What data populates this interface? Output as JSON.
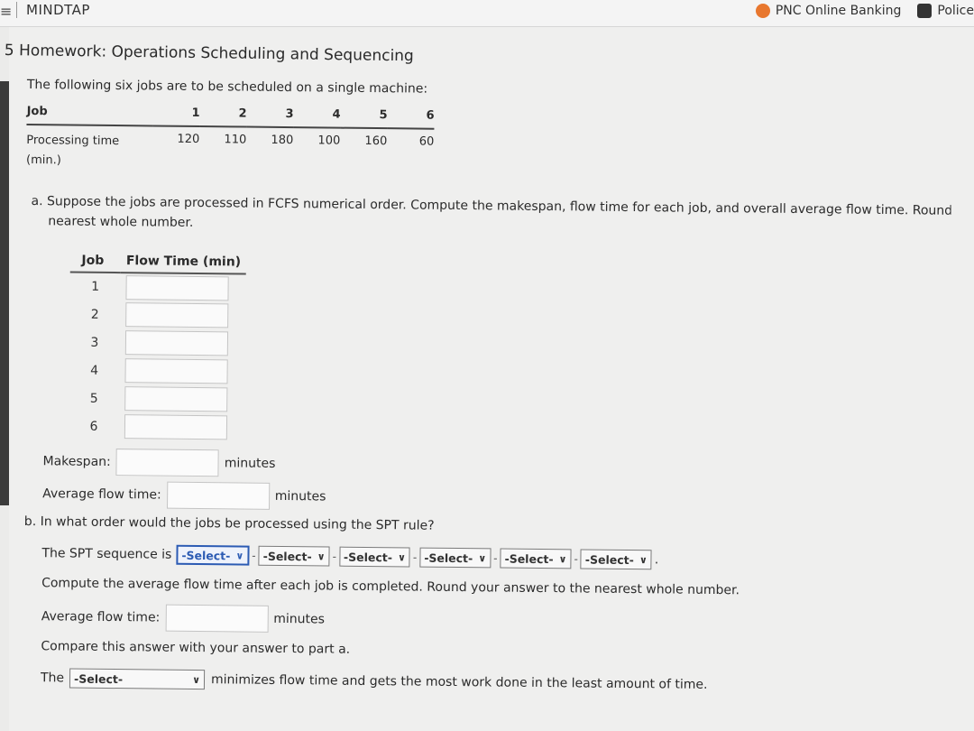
{
  "browser": {
    "brand": "MINDTAP",
    "bookmarks": [
      {
        "label": "PNC Online Banking",
        "icon": "pnc-logo-icon",
        "color": "#e8772e"
      },
      {
        "label": "Police",
        "icon": "police-badge-icon",
        "color": "#333333"
      }
    ]
  },
  "assignment": {
    "title": "5 Homework: Operations Scheduling and Sequencing",
    "intro": "The following six jobs are to be scheduled on a single machine:",
    "jobs_table": {
      "header_label": "Job",
      "jobs": [
        "1",
        "2",
        "3",
        "4",
        "5",
        "6"
      ],
      "row_label_line1": "Processing time",
      "row_label_line2": "(min.)",
      "processing_times": [
        "120",
        "110",
        "180",
        "100",
        "160",
        "60"
      ]
    }
  },
  "part_a": {
    "prompt_line1": "a. Suppose the jobs are processed in FCFS numerical order. Compute the makespan, flow time for each job, and overall average flow time. Round your a",
    "prompt_line2": "nearest whole number.",
    "table_headers": {
      "job": "Job",
      "flow": "Flow Time (min)"
    },
    "rows": [
      {
        "job": "1",
        "value": ""
      },
      {
        "job": "2",
        "value": ""
      },
      {
        "job": "3",
        "value": ""
      },
      {
        "job": "4",
        "value": ""
      },
      {
        "job": "5",
        "value": ""
      },
      {
        "job": "6",
        "value": ""
      }
    ],
    "makespan_label": "Makespan:",
    "makespan_unit": "minutes",
    "avg_label": "Average flow time:",
    "avg_unit": "minutes"
  },
  "part_b": {
    "question": "b. In what order would the jobs be processed using the SPT rule?",
    "sequence_label": "The SPT sequence is",
    "select_placeholder": "-Select-",
    "separator": "-",
    "end_mark": ".",
    "compute_prompt": "Compute the average flow time after each job is completed. Round your answer to the nearest whole number.",
    "avg_label": "Average flow time:",
    "avg_unit": "minutes",
    "compare_prompt": "Compare this answer with your answer to part a.",
    "final_prefix": "The",
    "final_select": "-Select-",
    "final_suffix": "minimizes flow time and gets the most work done in the least amount of time."
  }
}
